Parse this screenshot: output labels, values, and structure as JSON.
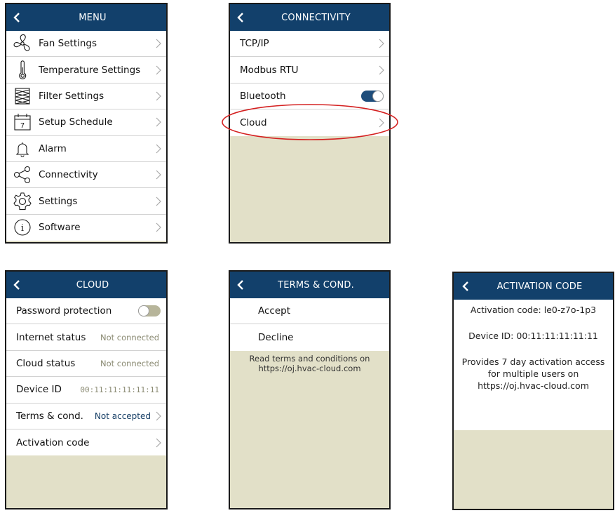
{
  "menu": {
    "title": "MENU",
    "items": [
      {
        "label": "Fan Settings"
      },
      {
        "label": "Temperature Settings"
      },
      {
        "label": "Filter Settings"
      },
      {
        "label": "Setup Schedule",
        "icon_text": "7"
      },
      {
        "label": "Alarm"
      },
      {
        "label": "Connectivity"
      },
      {
        "label": "Settings"
      },
      {
        "label": "Software",
        "icon_text": "i"
      }
    ]
  },
  "connectivity": {
    "title": "CONNECTIVITY",
    "items": [
      {
        "label": "TCP/IP"
      },
      {
        "label": "Modbus RTU"
      },
      {
        "label": "Bluetooth",
        "toggle": "on"
      },
      {
        "label": "Cloud"
      }
    ]
  },
  "cloud": {
    "title": "CLOUD",
    "items": [
      {
        "label": "Password protection",
        "toggle": "off"
      },
      {
        "label": "Internet status",
        "value": "Not connected"
      },
      {
        "label": "Cloud status",
        "value": "Not connected"
      },
      {
        "label": "Device ID",
        "value": "00:11:11:11:11:11"
      },
      {
        "label": "Terms & cond.",
        "value": "Not accepted"
      },
      {
        "label": "Activation code"
      }
    ]
  },
  "terms": {
    "title": "TERMS & COND.",
    "items": [
      {
        "label": "Accept"
      },
      {
        "label": "Decline"
      }
    ],
    "note_line1": "Read terms and conditions on",
    "note_line2": "https://oj.hvac-cloud.com"
  },
  "activation": {
    "title": "ACTIVATION CODE",
    "code_line": "Activation code: le0-z7o-1p3",
    "device_line": "Device ID: 00:11:11:11:11:11",
    "access_line1": "Provides 7 day activation access",
    "access_line2": "for multiple users on",
    "access_line3": "https://oj.hvac-cloud.com"
  },
  "colors": {
    "header": "#12406b",
    "panel_bg": "#e2e0c8",
    "highlight_ellipse": "#d42020"
  },
  "icons": {
    "back": "chevron-left-icon",
    "next": "chevron-right-icon",
    "fan": "fan-icon",
    "thermometer": "thermometer-icon",
    "filter": "filter-icon",
    "calendar": "calendar-icon",
    "alarm": "bell-icon",
    "connectivity": "share-icon",
    "settings": "gear-icon",
    "software": "info-icon"
  }
}
